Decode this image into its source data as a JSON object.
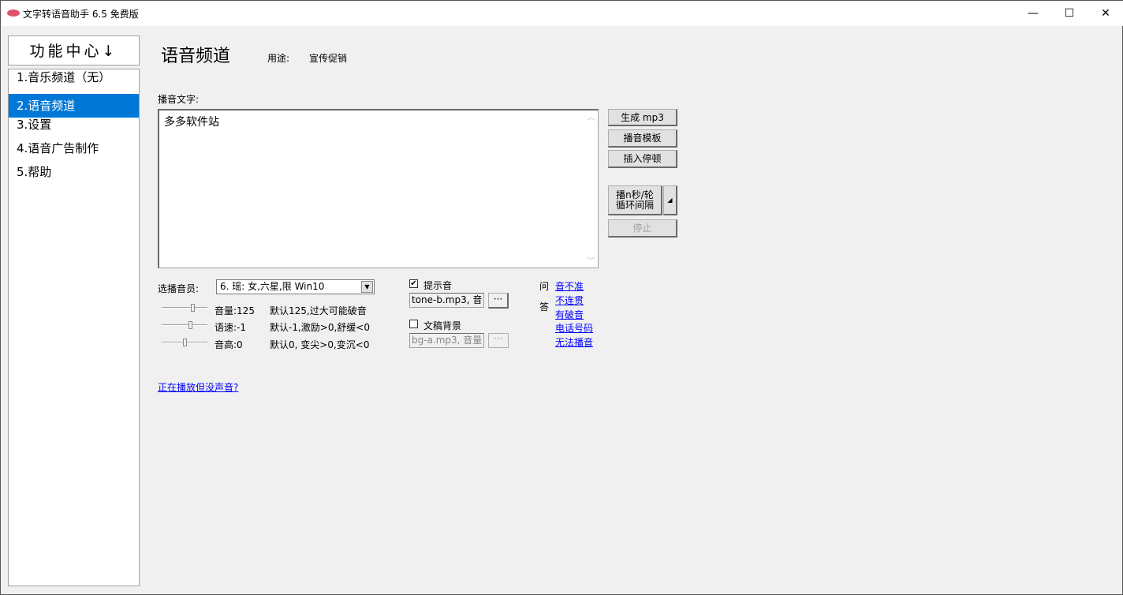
{
  "window": {
    "title": "文字转语音助手 6.5 免费版",
    "minimize": "—",
    "maximize": "☐",
    "close": "✕"
  },
  "sidebar": {
    "header": "功能中心↓",
    "items": [
      {
        "label": "1.音乐频道（无）"
      },
      {
        "label": "2.语音频道",
        "selected": true
      },
      {
        "label": "3.设置"
      },
      {
        "label": "4.语音广告制作"
      },
      {
        "label": "5.帮助"
      }
    ]
  },
  "main": {
    "title": "语音频道",
    "purpose_label": "用途:",
    "purpose_value": "宣传促销",
    "text_label": "播音文字:",
    "text_value": "多多软件站",
    "buttons": {
      "generate": "生成 mp3",
      "template": "播音模板",
      "pause": "插入停顿",
      "loop": "播n秒/轮\n循环间隔",
      "stop": "停止"
    },
    "voice_label": "选播音员:",
    "voice_value": "6. 瑶: 女,六星,限 Win10",
    "sliders": [
      {
        "label": "音量:125",
        "hint": "默认125,过大可能破音",
        "level": 0.7
      },
      {
        "label": "语速:-1",
        "hint": "默认-1,激励>0,舒缓<0",
        "level": 0.65
      },
      {
        "label": "音高:0",
        "hint": "默认0, 变尖>0,变沉<0",
        "level": 0.5
      }
    ],
    "tone": {
      "label": "提示音",
      "checked": true,
      "value": "tone-b.mp3, 音",
      "browse": "···"
    },
    "bg": {
      "label": "文稿背景",
      "checked": false,
      "value": "bg-a.mp3, 音量",
      "browse": "···"
    },
    "qa": {
      "q": "问",
      "a": "答",
      "links": [
        "音不准",
        "不连贯",
        "有破音",
        "电话号码",
        "无法播音"
      ]
    },
    "no_sound_link": "正在播放但没声音?"
  }
}
